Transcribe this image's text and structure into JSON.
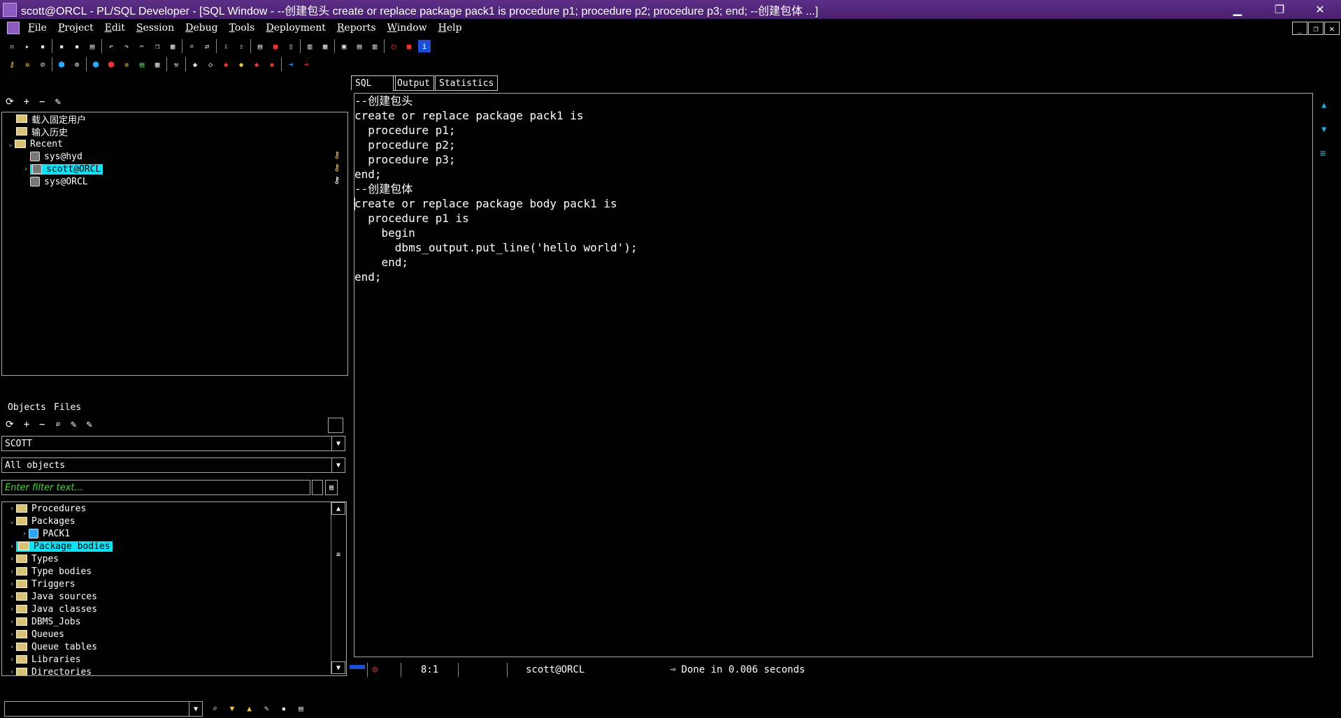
{
  "window": {
    "title": "scott@ORCL - PL/SQL Developer - [SQL Window - --创建包头 create or replace package pack1 is procedure p1; procedure p2; procedure p3; end; --创建包体  ...]",
    "min": "▁",
    "restore": "❐",
    "close": "✕"
  },
  "menu": [
    "File",
    "Project",
    "Edit",
    "Session",
    "Debug",
    "Tools",
    "Deployment",
    "Reports",
    "Window",
    "Help"
  ],
  "mdi": {
    "min": "_",
    "restore": "❐",
    "close": "✕"
  },
  "connections": {
    "toolbar": [
      "+",
      "−"
    ],
    "items": [
      {
        "label": "载入固定用户"
      },
      {
        "label": "输入历史"
      },
      {
        "label": "Recent"
      },
      {
        "label": "sys@hyd"
      },
      {
        "label": "scott@ORCL"
      },
      {
        "label": "sys@ORCL"
      }
    ]
  },
  "browser": {
    "tabs": [
      "Objects",
      "Files"
    ],
    "owner": "SCOTT",
    "filter_type": "All objects",
    "filter_placeholder": "Enter filter text...",
    "items": [
      {
        "label": "Procedures"
      },
      {
        "label": "Packages"
      },
      {
        "label": "PACK1"
      },
      {
        "label": "Package bodies"
      },
      {
        "label": "Types"
      },
      {
        "label": "Type bodies"
      },
      {
        "label": "Triggers"
      },
      {
        "label": "Java sources"
      },
      {
        "label": "Java classes"
      },
      {
        "label": "DBMS_Jobs"
      },
      {
        "label": "Queues"
      },
      {
        "label": "Queue tables"
      },
      {
        "label": "Libraries"
      },
      {
        "label": "Directories"
      }
    ]
  },
  "editor": {
    "tabs": [
      "SQL",
      "Output",
      "Statistics"
    ],
    "lines": [
      "--创建包头",
      "create or replace package pack1 is",
      "  procedure p1;",
      "  procedure p2;",
      "  procedure p3;",
      "end;",
      "--创建包体",
      "create or replace package body pack1 is",
      "  procedure p1 is",
      "    begin",
      "      dbms_output.put_line('hello world');",
      "    end;",
      "end;"
    ]
  },
  "status": {
    "position": "8:1",
    "connection": "scott@ORCL",
    "message": "Done in 0.006 seconds"
  },
  "colors": {
    "title_bg": "#4a2070",
    "selection": "#12e0f5",
    "filter_text": "#3fdc3f",
    "background": "#000000"
  }
}
